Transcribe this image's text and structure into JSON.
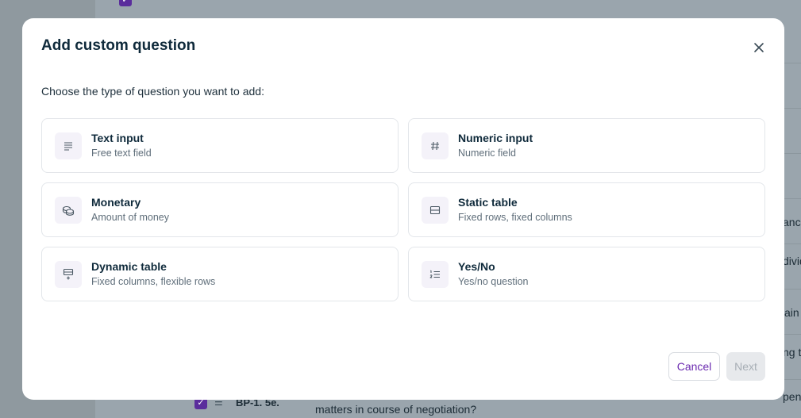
{
  "modal": {
    "title": "Add custom question",
    "subtitle": "Choose the type of question you want to add:",
    "options": [
      {
        "title": "Text input",
        "description": "Free text field",
        "icon": "text-lines-icon"
      },
      {
        "title": "Numeric input",
        "description": "Numeric field",
        "icon": "hash-icon"
      },
      {
        "title": "Monetary",
        "description": "Amount of money",
        "icon": "coins-icon"
      },
      {
        "title": "Static table",
        "description": "Fixed rows, fixed columns",
        "icon": "table-icon"
      },
      {
        "title": "Dynamic table",
        "description": "Fixed columns, flexible rows",
        "icon": "table-add-row-icon"
      },
      {
        "title": "Yes/No",
        "description": "Yes/no question",
        "icon": "numbered-list-icon"
      }
    ],
    "cancel_label": "Cancel",
    "next_label": "Next"
  },
  "background": {
    "row_code": "BP-1. 5e.",
    "row_text": "matters in course of negotiation?",
    "fragments": [
      "ancia",
      "divid",
      "ain",
      "ng to",
      "pend"
    ]
  },
  "colors": {
    "accent": "#6b2ab0",
    "overlay": "#9aa5ad",
    "checkbox": "#5a2d9c"
  }
}
